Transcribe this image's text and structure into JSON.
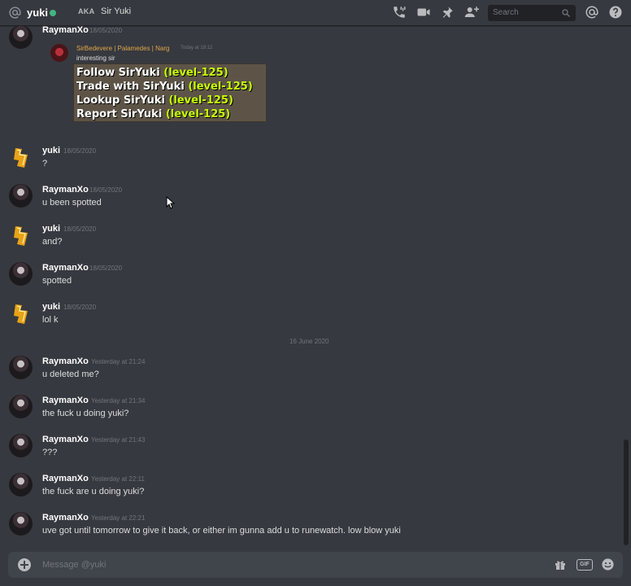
{
  "header": {
    "channel_name": "yuki",
    "aka_label": "AKA",
    "aka_name": "Sir Yuki",
    "search_placeholder": "Search",
    "status_color": "#43b581"
  },
  "embed": {
    "author": "SirBedevere | Palamedes | Narg",
    "timestamp": "Today at 19:12",
    "text": "interesting sir",
    "menu": [
      {
        "action": "Follow SirYuki",
        "level": "(level-125)"
      },
      {
        "action": "Trade with SirYuki",
        "level": "(level-125)"
      },
      {
        "action": "Lookup SirYuki",
        "level": "(level-125)"
      },
      {
        "action": "Report SirYuki",
        "level": "(level-125)"
      }
    ]
  },
  "messages": [
    {
      "author": "RaymanXo",
      "timestamp": "18/05/2020",
      "content": ""
    },
    {
      "author": "yuki",
      "timestamp": "18/05/2020",
      "content": "?"
    },
    {
      "author": "RaymanXo",
      "timestamp": "18/05/2020",
      "content": "u been spotted"
    },
    {
      "author": "yuki",
      "timestamp": "18/05/2020",
      "content": "and?"
    },
    {
      "author": "RaymanXo",
      "timestamp": "18/05/2020",
      "content": "spotted"
    },
    {
      "author": "yuki",
      "timestamp": "18/05/2020",
      "content": "lol k"
    },
    {
      "author": "RaymanXo",
      "timestamp": "Yesterday at 21:24",
      "content": "u deleted me?"
    },
    {
      "author": "RaymanXo",
      "timestamp": "Yesterday at 21:34",
      "content": "the fuck u doing yuki?"
    },
    {
      "author": "RaymanXo",
      "timestamp": "Yesterday at 21:43",
      "content": "???"
    },
    {
      "author": "RaymanXo",
      "timestamp": "Yesterday at 22:11",
      "content": "the fuck are u doing yuki?"
    },
    {
      "author": "RaymanXo",
      "timestamp": "Yesterday at 22:21",
      "content": "uve got until tomorrow to give it back, or either im gunna add u to runewatch. low blow yuki"
    }
  ],
  "divider_date": "16 June 2020",
  "composer": {
    "placeholder": "Message @yuki",
    "gif_label": "GIF"
  },
  "colors": {
    "background": "#36393f",
    "header_border": "#202225",
    "timestamp": "#72767d",
    "text": "#dcddde",
    "embed_author": "#e1a64a",
    "menu_level": "#c8ff00"
  },
  "icons": [
    "at-icon",
    "phone-call-icon",
    "video-icon",
    "pin-icon",
    "add-friend-icon",
    "search-icon",
    "mention-icon",
    "help-icon",
    "plus-icon",
    "gift-icon",
    "emoji-icon"
  ]
}
